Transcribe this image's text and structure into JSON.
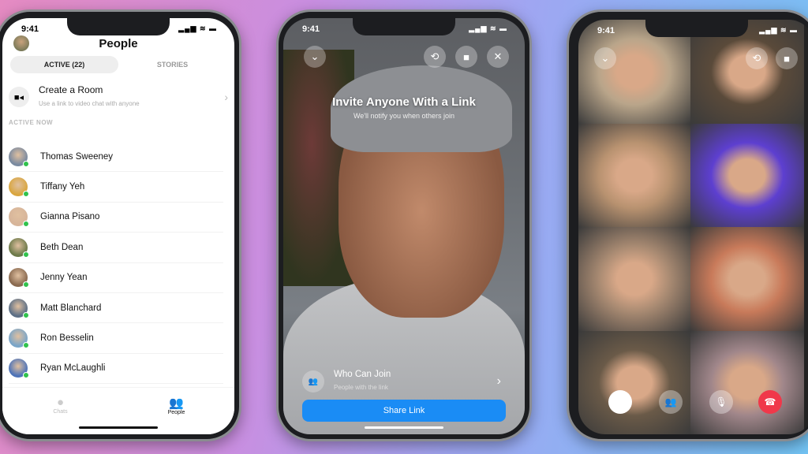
{
  "status_time": "9:41",
  "people_screen": {
    "title": "People",
    "tabs": [
      {
        "label": "ACTIVE (22)",
        "active": true
      },
      {
        "label": "STORIES",
        "active": false
      }
    ],
    "create_room": {
      "title": "Create a Room",
      "subtitle": "Use a link to video chat with anyone"
    },
    "section_label": "ACTIVE NOW",
    "people": [
      {
        "name": "Thomas Sweeney",
        "color": "#7a8aa0"
      },
      {
        "name": "Tiffany Yeh",
        "color": "#d9a640"
      },
      {
        "name": "Gianna Pisano",
        "color": "#d7b59a"
      },
      {
        "name": "Beth Dean",
        "color": "#6d7a4a"
      },
      {
        "name": "Jenny Yean",
        "color": "#8a6a50"
      },
      {
        "name": "Matt Blanchard",
        "color": "#5c6f86"
      },
      {
        "name": "Ron Besselin",
        "color": "#7aa5c8"
      },
      {
        "name": "Ryan McLaughli",
        "color": "#4e73b8"
      }
    ],
    "tabbar": [
      {
        "label": "Chats",
        "icon": "chat-bubble-icon",
        "active": false
      },
      {
        "label": "People",
        "icon": "people-icon",
        "active": true
      }
    ]
  },
  "invite_screen": {
    "title": "Invite Anyone With a Link",
    "subtitle": "We'll notify you when others join",
    "who_can_join": {
      "title": "Who Can Join",
      "subtitle": "People with the link"
    },
    "share_button": "Share Link",
    "accent": "#1a8cf5"
  },
  "call_screen": {
    "tiles": [
      "#b9a58a",
      "#5a4a3a",
      "#b89270",
      "#5d3fd0",
      "#a88a72",
      "#c87a5a",
      "#6a5a48",
      "#a0868a"
    ],
    "end_call_color": "#f0384a"
  }
}
